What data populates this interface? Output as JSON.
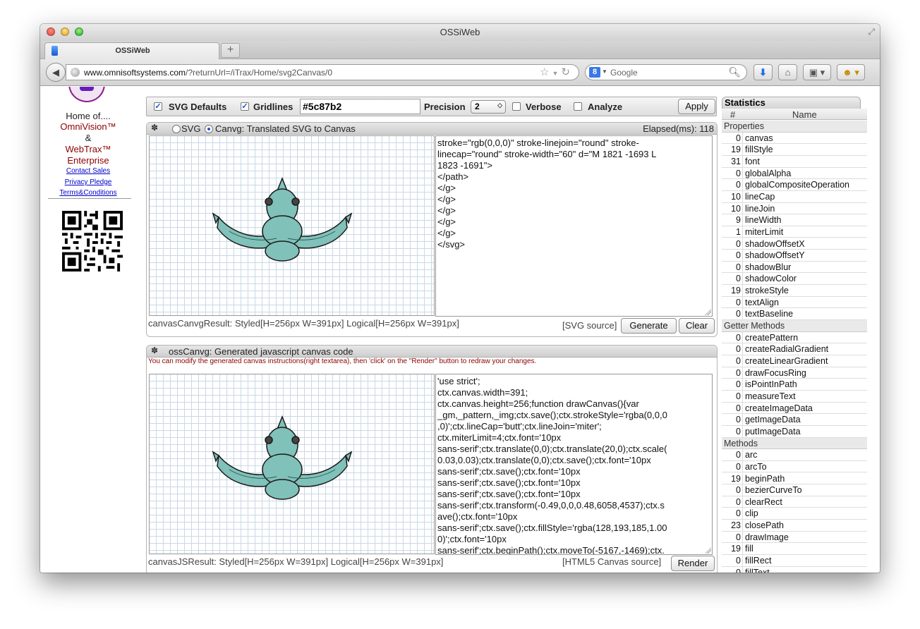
{
  "window": {
    "title": "OSSiWeb"
  },
  "tab": {
    "title": "OSSiWeb",
    "new_tab": "+"
  },
  "nav": {
    "url_domain": "www.omnisoftsystems.com",
    "url_path": "/?returnUrl=/iTrax/Home/svg2Canvas/0",
    "search_badge": "8",
    "search_placeholder": "Google"
  },
  "sidebar": {
    "home_of": "Home of....",
    "brand1": "OmniVision™",
    "amp": "&",
    "brand2": "WebTrax™",
    "brand3": "Enterprise",
    "links": [
      "Contact Sales",
      "Privacy Pledge",
      "Terms&Conditions"
    ]
  },
  "toolbar": {
    "svg_defaults": "SVG Defaults",
    "gridlines": "Gridlines",
    "grid_color": "#5c87b2",
    "precision_label": "Precision",
    "precision_value": "2",
    "verbose": "Verbose",
    "analyze": "Analyze",
    "apply": "Apply"
  },
  "panel1": {
    "radio_svg": "SVG",
    "title": "Canvg: Translated SVG to Canvas",
    "elapsed": "Elapsed(ms): 118",
    "code_lines": [
      "stroke=\"rgb(0,0,0)\" stroke-linejoin=\"round\" stroke-",
      "linecap=\"round\" stroke-width=\"60\" d=\"M 1821 -1693 L",
      "1823 -1691\">",
      "",
      "</path>",
      "",
      "</g>",
      "",
      "</g>",
      "",
      "</g>",
      "",
      "</g>",
      "",
      "</g>",
      "",
      "</svg>"
    ],
    "result": "canvasCanvgResult: Styled[H=256px W=391px] Logical[H=256px W=391px]",
    "source": "[SVG source]",
    "generate": "Generate",
    "clear": "Clear"
  },
  "panel2": {
    "title": "ossCanvg: Generated javascript canvas code",
    "note": "You can modify the generated canvas instructions(right textarea), then 'click' on the \"Render\" button to redraw your changes.",
    "code_lines": [
      "'use strict';",
      "ctx.canvas.width=391;",
      "ctx.canvas.height=256;function drawCanvas(){var",
      "_gm,_pattern,_img;ctx.save();ctx.strokeStyle='rgba(0,0,0",
      ",0)';ctx.lineCap='butt';ctx.lineJoin='miter';",
      "ctx.miterLimit=4;ctx.font='10px",
      "sans-serif';ctx.translate(0,0);ctx.translate(20,0);ctx.scale(",
      "0.03,0.03);ctx.translate(0,0);ctx.save();ctx.font='10px",
      "sans-serif';ctx.save();ctx.font='10px",
      "sans-serif';ctx.save();ctx.font='10px",
      "sans-serif';ctx.save();ctx.font='10px",
      "sans-serif';ctx.transform(-0.49,0,0,0.48,6058,4537);ctx.s",
      "ave();ctx.font='10px",
      "sans-serif';ctx.save();ctx.fillStyle='rgba(128,193,185,1.00",
      "0)';ctx.font='10px",
      "sans-serif';ctx.beginPath();ctx.moveTo(-5167,-1469);ctx."
    ],
    "result": "canvasJSResult: Styled[H=256px W=391px] Logical[H=256px W=391px]",
    "source": "[HTML5 Canvas source]",
    "render": "Render"
  },
  "stats": {
    "tab": "Statistics",
    "col_num": "#",
    "col_name": "Name",
    "sections": [
      {
        "title": "Properties",
        "rows": [
          {
            "n": "0",
            "name": "canvas"
          },
          {
            "n": "19",
            "name": "fillStyle"
          },
          {
            "n": "31",
            "name": "font"
          },
          {
            "n": "0",
            "name": "globalAlpha"
          },
          {
            "n": "0",
            "name": "globalCompositeOperation"
          },
          {
            "n": "10",
            "name": "lineCap"
          },
          {
            "n": "10",
            "name": "lineJoin"
          },
          {
            "n": "9",
            "name": "lineWidth"
          },
          {
            "n": "1",
            "name": "miterLimit"
          },
          {
            "n": "0",
            "name": "shadowOffsetX"
          },
          {
            "n": "0",
            "name": "shadowOffsetY"
          },
          {
            "n": "0",
            "name": "shadowBlur"
          },
          {
            "n": "0",
            "name": "shadowColor"
          },
          {
            "n": "19",
            "name": "strokeStyle"
          },
          {
            "n": "0",
            "name": "textAlign"
          },
          {
            "n": "0",
            "name": "textBaseline"
          }
        ]
      },
      {
        "title": "Getter Methods",
        "rows": [
          {
            "n": "0",
            "name": "createPattern"
          },
          {
            "n": "0",
            "name": "createRadialGradient"
          },
          {
            "n": "0",
            "name": "createLinearGradient"
          },
          {
            "n": "0",
            "name": "drawFocusRing"
          },
          {
            "n": "0",
            "name": "isPointInPath"
          },
          {
            "n": "0",
            "name": "measureText"
          },
          {
            "n": "0",
            "name": "createImageData"
          },
          {
            "n": "0",
            "name": "getImageData"
          },
          {
            "n": "0",
            "name": "putImageData"
          }
        ]
      },
      {
        "title": "Methods",
        "rows": [
          {
            "n": "0",
            "name": "arc"
          },
          {
            "n": "0",
            "name": "arcTo"
          },
          {
            "n": "19",
            "name": "beginPath"
          },
          {
            "n": "0",
            "name": "bezierCurveTo"
          },
          {
            "n": "0",
            "name": "clearRect"
          },
          {
            "n": "0",
            "name": "clip"
          },
          {
            "n": "23",
            "name": "closePath"
          },
          {
            "n": "0",
            "name": "drawImage"
          },
          {
            "n": "19",
            "name": "fill"
          },
          {
            "n": "0",
            "name": "fillRect"
          },
          {
            "n": "0",
            "name": "fillText"
          }
        ]
      }
    ]
  },
  "colors": {
    "grid": "#5c87b2",
    "brand_red": "#8b0000",
    "creature": "#80c1b9"
  }
}
